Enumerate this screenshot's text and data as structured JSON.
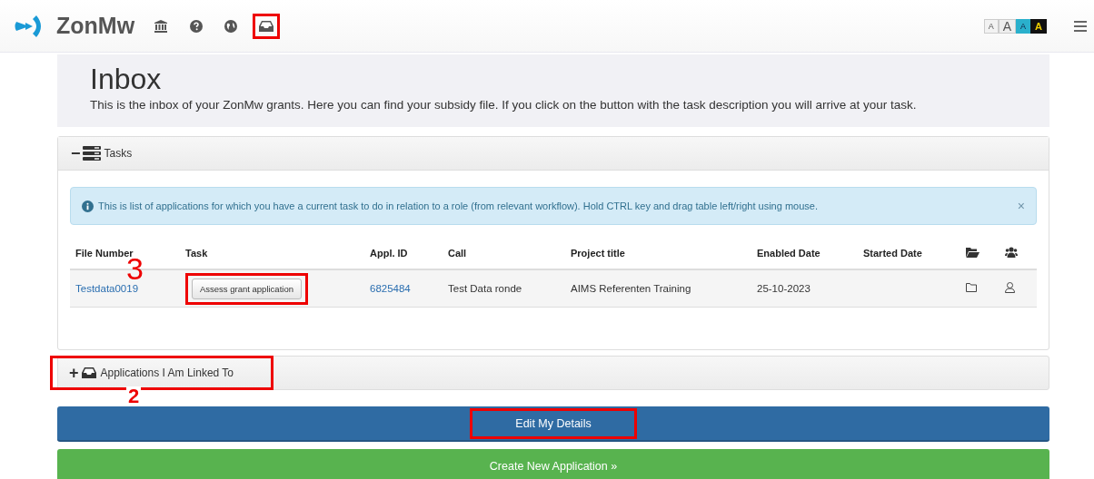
{
  "header": {
    "logo": "ZonMw",
    "nav_icons": [
      {
        "kind": "bank",
        "highlighted": false
      },
      {
        "kind": "help",
        "highlighted": false
      },
      {
        "kind": "globe",
        "highlighted": false
      },
      {
        "kind": "inbox",
        "highlighted": true
      }
    ],
    "font_buttons": [
      {
        "label": "A",
        "kind": "small"
      },
      {
        "label": "A",
        "kind": "large"
      },
      {
        "label": "A",
        "kind": "blue"
      },
      {
        "label": "A",
        "kind": "dark"
      }
    ]
  },
  "intro": {
    "title": "Inbox",
    "text": "This is the inbox of your ZonMw grants. Here you can find your subsidy file. If you click on the button with the task description you will arrive at your task."
  },
  "tasks_panel": {
    "toggle": "−",
    "title": "Tasks",
    "expanded": true,
    "info": "This is list of applications for which you have a current task to do in relation to a role (from relevant workflow). Hold CTRL key and drag table left/right using mouse.",
    "close": "×",
    "columns": [
      {
        "kind": "text",
        "label": "File Number"
      },
      {
        "kind": "text",
        "label": "Task"
      },
      {
        "kind": "text",
        "label": "Appl. ID"
      },
      {
        "kind": "text",
        "label": "Call"
      },
      {
        "kind": "text",
        "label": "Project title"
      },
      {
        "kind": "text",
        "label": "Enabled Date"
      },
      {
        "kind": "text",
        "label": "Started Date"
      },
      {
        "kind": "folder-icon"
      },
      {
        "kind": "users-icon"
      }
    ],
    "rows": [
      {
        "file_number": "Testdata0019",
        "task": "Assess grant application",
        "task_highlighted": true,
        "task_annotation": "3",
        "appl_id": "6825484",
        "call": "Test Data ronde",
        "project_title": "AIMS Referenten Training",
        "enabled_date": "25-10-2023"
      }
    ]
  },
  "linked_panel": {
    "toggle": "+",
    "title": "Applications I Am Linked To",
    "highlighted": true,
    "annotation": "2"
  },
  "buttons": [
    {
      "label": "Edit My Details",
      "kind": "primary",
      "highlighted": true
    },
    {
      "label": "Create New Application »",
      "kind": "success",
      "highlighted": false
    }
  ]
}
